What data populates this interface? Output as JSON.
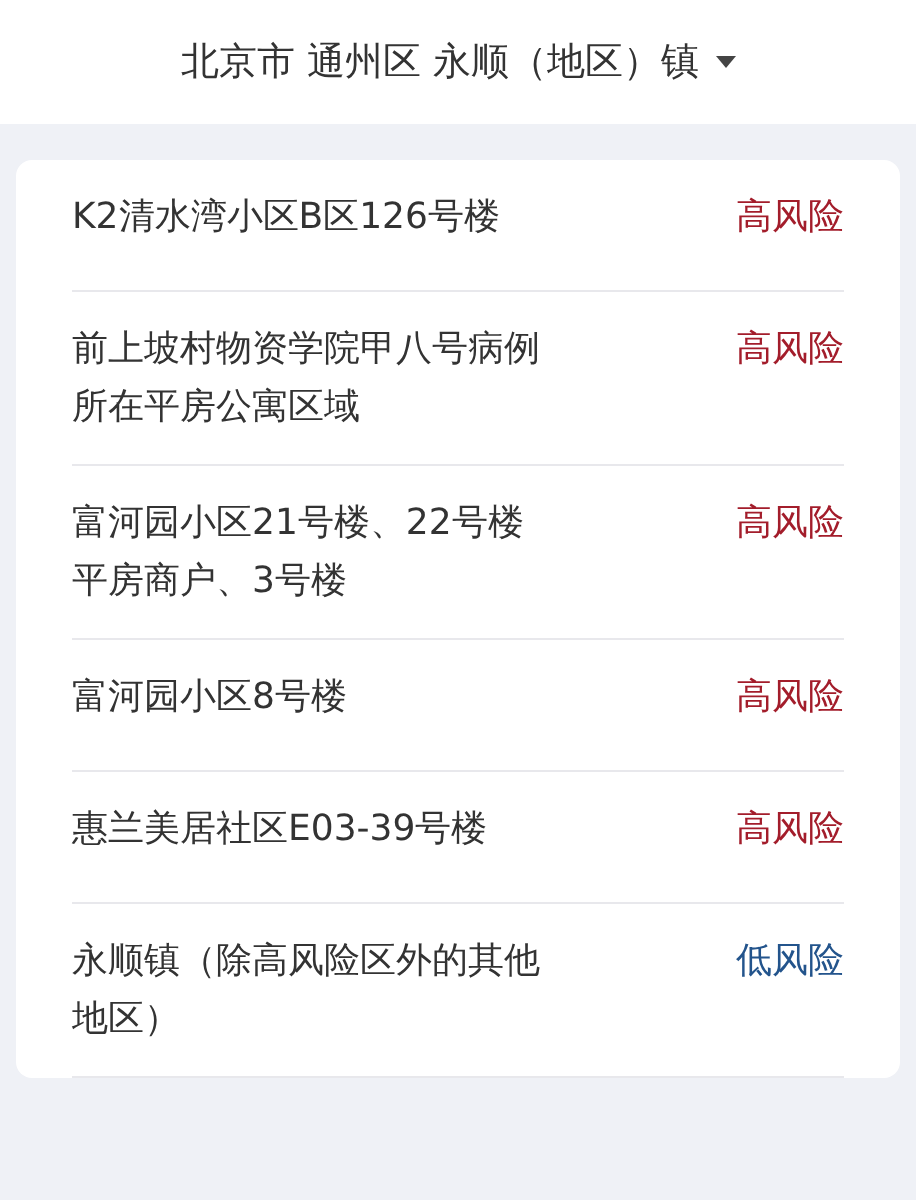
{
  "header": {
    "title": "北京市 通州区 永顺（地区）镇"
  },
  "areas": [
    {
      "name": "K2清水湾小区B区126号楼",
      "risk": "高风险",
      "kind": "high"
    },
    {
      "name": "前上坡村物资学院甲八号病例所在平房公寓区域",
      "risk": "高风险",
      "kind": "high"
    },
    {
      "name": "富河园小区21号楼、22号楼平房商户、3号楼",
      "risk": "高风险",
      "kind": "high"
    },
    {
      "name": "富河园小区8号楼",
      "risk": "高风险",
      "kind": "high"
    },
    {
      "name": "惠兰美居社区E03-39号楼",
      "risk": "高风险",
      "kind": "high"
    },
    {
      "name": "永顺镇（除高风险区外的其他地区）",
      "risk": "低风险",
      "kind": "low"
    }
  ]
}
